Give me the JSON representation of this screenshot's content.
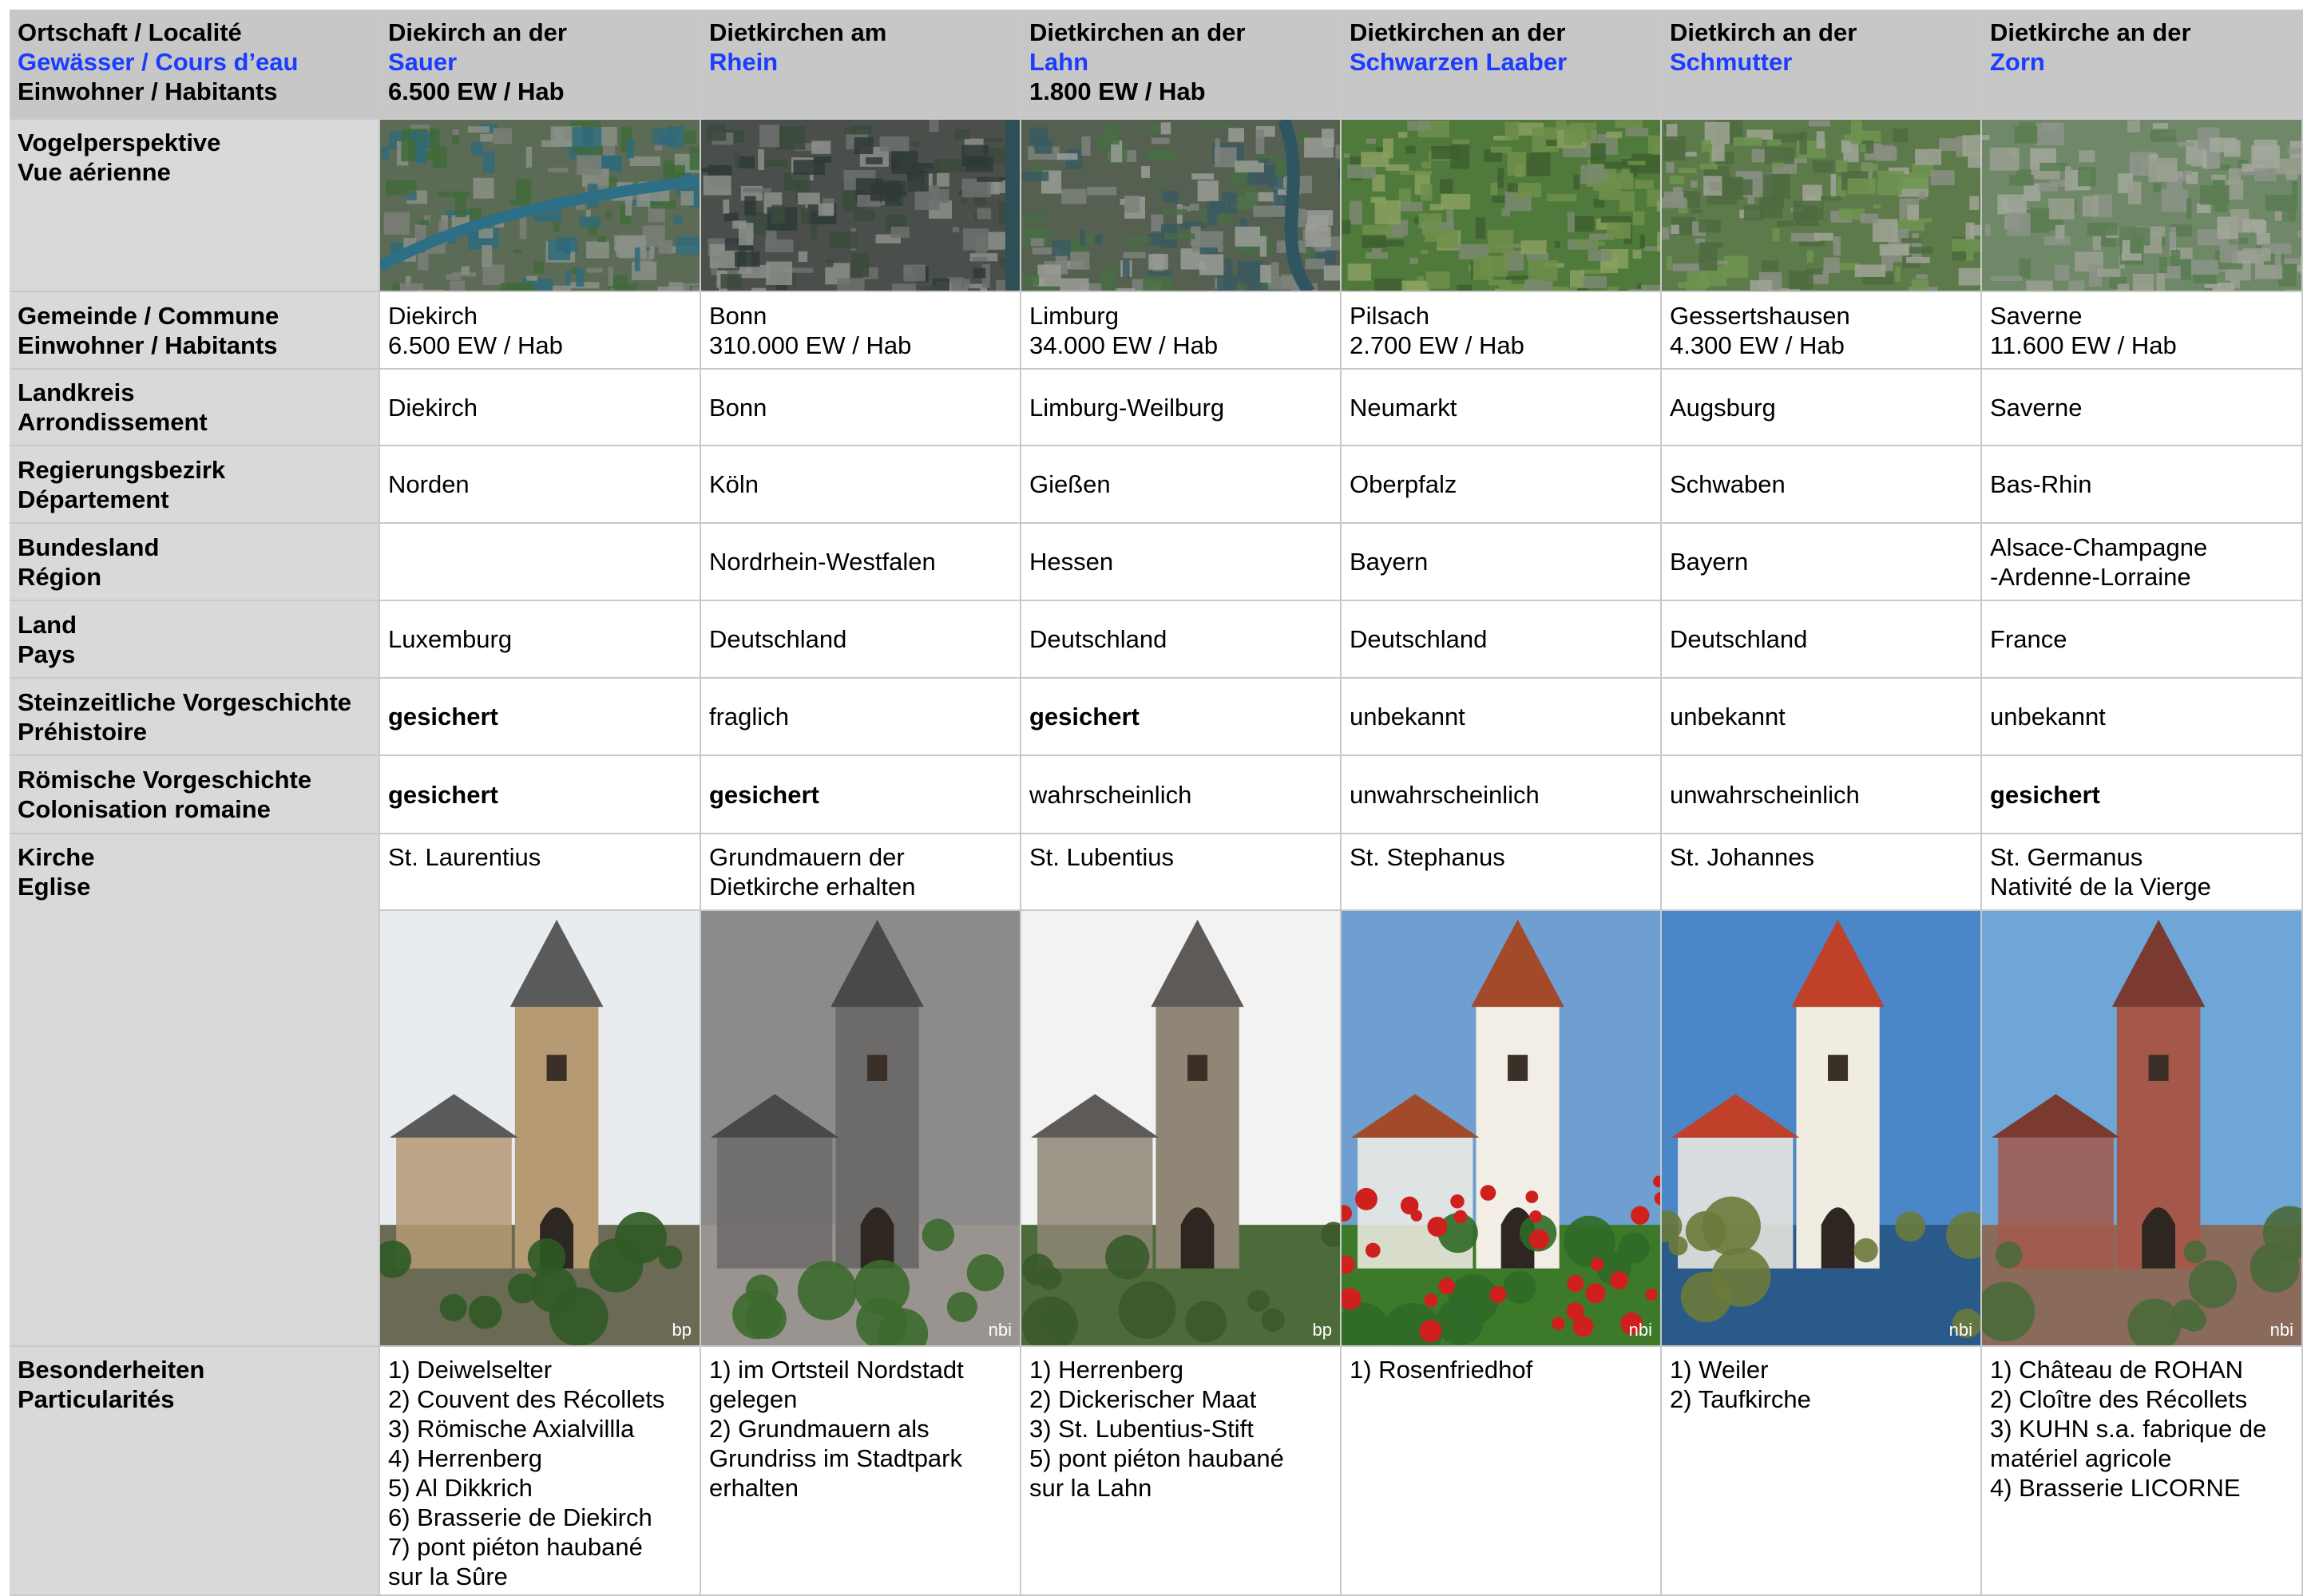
{
  "header": {
    "label_l1": "Ortschaft / Localité",
    "label_l2": "Gewässer / Cours d’eau",
    "label_l3": "Einwohner / Habitants"
  },
  "localities": [
    {
      "name": "Diekirch an der",
      "river": "Sauer",
      "pop": "6.500 EW / Hab"
    },
    {
      "name": "Dietkirchen am",
      "river": "Rhein",
      "pop": ""
    },
    {
      "name": "Dietkirchen an der",
      "river": "Lahn",
      "pop": "1.800 EW / Hab"
    },
    {
      "name": "Dietkirchen an der",
      "river": "Schwarzen Laaber",
      "pop": ""
    },
    {
      "name": "Dietkirch an der",
      "river": "Schmutter",
      "pop": ""
    },
    {
      "name": "Dietkirche an der",
      "river": "Zorn",
      "pop": ""
    }
  ],
  "rows": {
    "aerial": {
      "l1": "Vogelperspektive",
      "l2": "Vue aérienne"
    },
    "commune": {
      "l1": "Gemeinde / Commune",
      "l2": "Einwohner / Habitants",
      "values": [
        [
          "Diekirch",
          "6.500 EW / Hab"
        ],
        [
          "Bonn",
          "310.000 EW / Hab"
        ],
        [
          "Limburg",
          "34.000 EW / Hab"
        ],
        [
          "Pilsach",
          "2.700 EW / Hab"
        ],
        [
          "Gessertshausen",
          "4.300 EW / Hab"
        ],
        [
          "Saverne",
          "11.600 EW / Hab"
        ]
      ]
    },
    "landkreis": {
      "l1": "Landkreis",
      "l2": "Arrondissement",
      "values": [
        "Diekirch",
        "Bonn",
        "Limburg-Weilburg",
        "Neumarkt",
        "Augsburg",
        "Saverne"
      ]
    },
    "regbez": {
      "l1": "Regierungsbezirk",
      "l2": "Département",
      "values": [
        "Norden",
        "Köln",
        "Gießen",
        "Oberpfalz",
        "Schwaben",
        "Bas-Rhin"
      ]
    },
    "bundesland": {
      "l1": "Bundesland",
      "l2": "Région",
      "values": [
        [
          ""
        ],
        [
          "Nordrhein-Westfalen"
        ],
        [
          "Hessen"
        ],
        [
          "Bayern"
        ],
        [
          "Bayern"
        ],
        [
          "Alsace-Champagne",
          "-Ardenne-Lorraine"
        ]
      ]
    },
    "land": {
      "l1": "Land",
      "l2": "Pays",
      "values": [
        "Luxemburg",
        "Deutschland",
        "Deutschland",
        "Deutschland",
        "Deutschland",
        "France"
      ]
    },
    "prehistory": {
      "l1": "Steinzeitliche Vorgeschichte",
      "l2": "Préhistoire",
      "values": [
        {
          "text": "gesichert",
          "bold": true
        },
        {
          "text": "fraglich",
          "bold": false
        },
        {
          "text": "gesichert",
          "bold": true
        },
        {
          "text": "unbekannt",
          "bold": false
        },
        {
          "text": "unbekannt",
          "bold": false
        },
        {
          "text": "unbekannt",
          "bold": false
        }
      ]
    },
    "roman": {
      "l1": "Römische Vorgeschichte",
      "l2": "Colonisation romaine",
      "values": [
        {
          "text": "gesichert",
          "bold": true
        },
        {
          "text": "gesichert",
          "bold": true
        },
        {
          "text": "wahrscheinlich",
          "bold": false
        },
        {
          "text": "unwahrscheinlich",
          "bold": false
        },
        {
          "text": "unwahrscheinlich",
          "bold": false
        },
        {
          "text": "gesichert",
          "bold": true
        }
      ]
    },
    "church": {
      "l1": "Kirche",
      "l2": "Eglise",
      "values": [
        [
          "St. Laurentius"
        ],
        [
          "Grundmauern der",
          "Dietkirche erhalten"
        ],
        [
          "St. Lubentius"
        ],
        [
          "St. Stephanus"
        ],
        [
          "St. Johannes"
        ],
        [
          "St. Germanus",
          "Nativité de la Vierge"
        ]
      ],
      "credits": [
        "bp",
        "nbi",
        "bp",
        "nbi",
        "nbi",
        "nbi"
      ]
    },
    "features": {
      "l1": "Besonderheiten",
      "l2": "Particularités",
      "values": [
        [
          "1) Deiwelselter",
          "2) Couvent des Récollets",
          "3) Römische Axialvillla",
          "4) Herrenberg",
          "5) Al Dikkrich",
          "6) Brasserie de Diekirch",
          "7) pont piéton haubané",
          "sur la Sûre"
        ],
        [
          "1) im Ortsteil Nordstadt",
          "gelegen",
          "2) Grundmauern als",
          "Grundriss im Stadtpark",
          "erhalten"
        ],
        [
          "1) Herrenberg",
          "2) Dickerischer Maat",
          "3) St. Lubentius-Stift",
          "5) pont piéton haubané",
          "sur la Lahn"
        ],
        [
          "1) Rosenfriedhof"
        ],
        [
          "1) Weiler",
          "2) Taufkirche"
        ],
        [
          "1) Château de ROHAN",
          "2) Cloître des Récollets",
          "3) KUHN s.a. fabrique de",
          "matériel  agricole",
          "4) Brasserie LICORNE"
        ]
      ]
    }
  },
  "colors": {
    "header_bg": "#c7c7c7",
    "label_bg": "#d9d9d9",
    "river_blue": "#1b3dff",
    "border": "#c9c9c9"
  },
  "images": {
    "aerial": [
      "aerial-diekirch",
      "aerial-bonn",
      "aerial-limburg",
      "aerial-pilsach",
      "aerial-gessertshausen",
      "aerial-saverne"
    ],
    "church": [
      "church-st-laurentius",
      "church-dietkirche-bonn",
      "church-st-lubentius",
      "church-st-stephanus",
      "church-st-johannes",
      "church-st-germanus"
    ]
  }
}
